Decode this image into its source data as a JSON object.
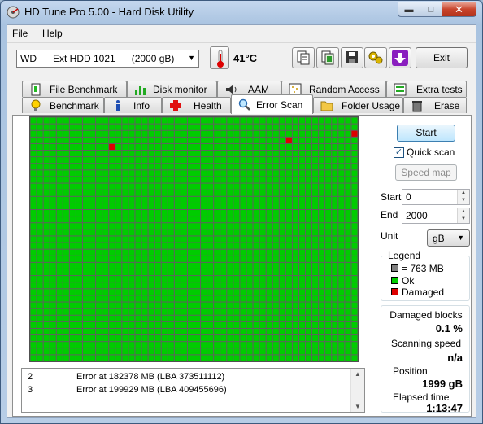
{
  "window": {
    "title": "HD Tune Pro 5.00 - Hard Disk Utility"
  },
  "menu": {
    "file": "File",
    "help": "Help"
  },
  "toolbar": {
    "drive": "WD      Ext HDD 1021      (2000 gB)",
    "temperature": "41°C",
    "exit_label": "Exit"
  },
  "tabs_top": [
    {
      "label": "File Benchmark"
    },
    {
      "label": "Disk monitor"
    },
    {
      "label": "AAM"
    },
    {
      "label": "Random Access"
    },
    {
      "label": "Extra tests"
    }
  ],
  "tabs_bottom": [
    {
      "label": "Benchmark"
    },
    {
      "label": "Info"
    },
    {
      "label": "Health"
    },
    {
      "label": "Error Scan"
    },
    {
      "label": "Folder Usage"
    },
    {
      "label": "Erase"
    }
  ],
  "scan": {
    "start_button": "Start",
    "quick_scan_label": "Quick scan",
    "quick_scan_checked": true,
    "speed_map_button": "Speed map",
    "start_label": "Start",
    "start_value": "0",
    "end_label": "End",
    "end_value": "2000",
    "unit_label": "Unit",
    "unit_value": "gB"
  },
  "legend": {
    "title": "Legend",
    "items": [
      {
        "label": "= 763 MB",
        "color": "#808080"
      },
      {
        "label": "Ok",
        "color": "#00cc00"
      },
      {
        "label": "Damaged",
        "color": "#dd0000"
      }
    ]
  },
  "stats": {
    "damaged_blocks_label": "Damaged blocks",
    "damaged_blocks_value": "0.1 %",
    "scanning_speed_label": "Scanning speed",
    "scanning_speed_value": "n/a",
    "position_label": "Position",
    "position_value": "1999 gB",
    "elapsed_label": "Elapsed time",
    "elapsed_value": "1:13:47"
  },
  "log": [
    {
      "num": "2",
      "message": "Error at 182378 MB (LBA 373511112)"
    },
    {
      "num": "3",
      "message": "Error at 199929 MB (LBA 409455696)"
    }
  ],
  "grid": {
    "cols": 50,
    "rows": 37,
    "ok_color": "#00cc00",
    "damaged_color": "#dd0000",
    "damaged_cells": [
      [
        12,
        4
      ],
      [
        39,
        3
      ],
      [
        49,
        2
      ]
    ]
  }
}
